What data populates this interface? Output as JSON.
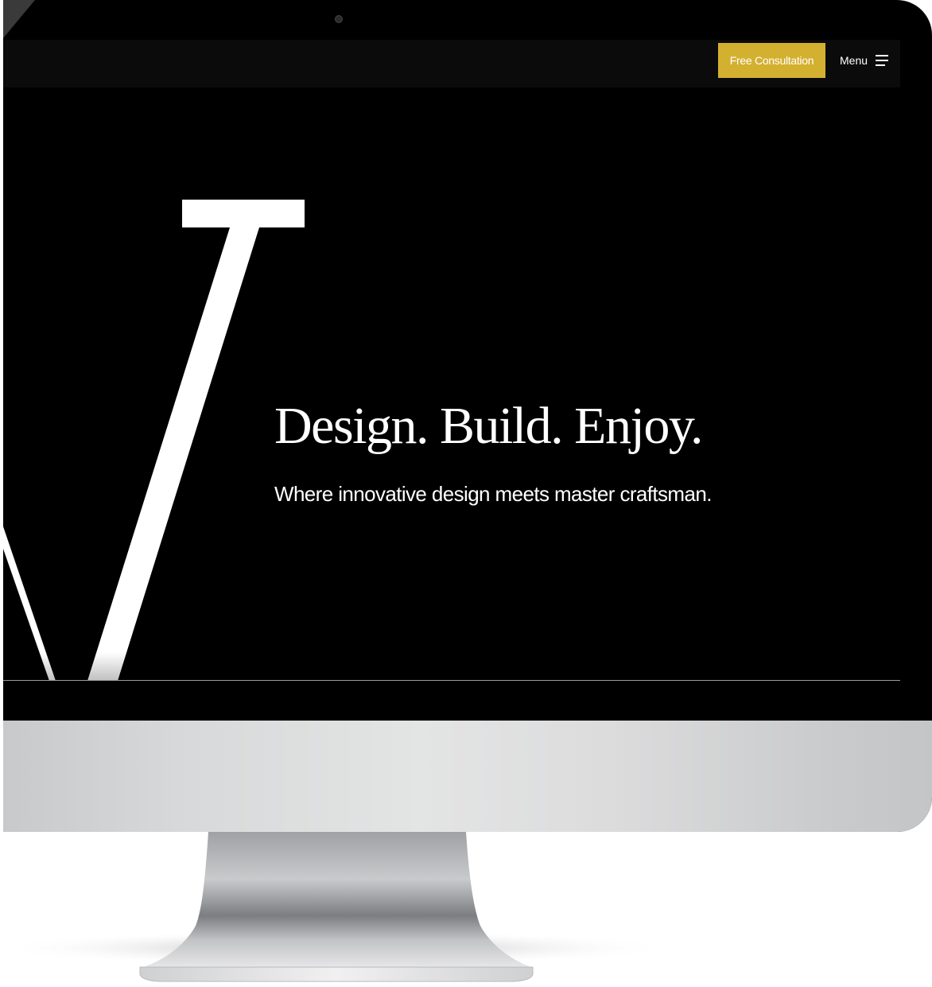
{
  "navbar": {
    "cta_label": "Free Consultation",
    "menu_label": "Menu",
    "menu_icon": "hamburger-icon"
  },
  "hero": {
    "heading": "Design. Build. Enjoy.",
    "subheading": "Where innovative design meets master craftsman."
  },
  "colors": {
    "accent": "#d4b030",
    "background": "#000000",
    "text": "#ffffff"
  }
}
